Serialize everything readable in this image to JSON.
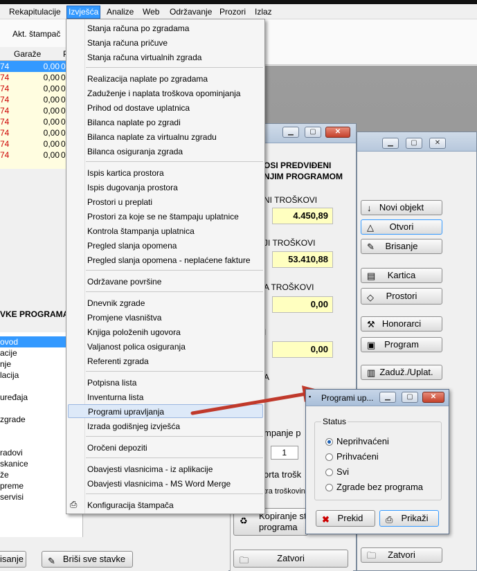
{
  "menubar": {
    "items": [
      "Rekapitulacije",
      "Izvješća",
      "Analize",
      "Web",
      "Održavanje",
      "Prozori",
      "Izlaz"
    ],
    "selected": "Izvješća"
  },
  "toolbar": {
    "label": "Akt. štampač"
  },
  "left_window": {
    "grid_headers": [
      "Garaže",
      "P"
    ],
    "rows": [
      {
        "a": "74",
        "b": "0,00",
        "c": "0,0"
      },
      {
        "a": "74",
        "b": "0,00",
        "c": "0,0"
      },
      {
        "a": "74",
        "b": "0,00",
        "c": "0,0"
      },
      {
        "a": "74",
        "b": "0,00",
        "c": "0,0"
      },
      {
        "a": "74",
        "b": "0,00",
        "c": "0,0"
      },
      {
        "a": "74",
        "b": "0,00",
        "c": "0,0"
      },
      {
        "a": "74",
        "b": "0,00",
        "c": "0,0"
      },
      {
        "a": "74",
        "b": "0,00",
        "c": "0,0"
      },
      {
        "a": "74",
        "b": "0,00",
        "c": "0,0"
      }
    ],
    "stavke_header": "VKE PROGRAMA",
    "stavke_items": [
      "ovod",
      "acije",
      "nje",
      "lacija",
      "uređaja",
      "zgrade",
      "radovi",
      "skanice",
      "že",
      "preme",
      "servisi"
    ],
    "btn_brisanje": "isanje",
    "btn_brisi_sve": "Briši sve stavke"
  },
  "middle_window": {
    "heading1": "OSI PREDVIĐENI",
    "heading2": "NJIM PROGRAMOM",
    "label1": "NI TROŠKOVI",
    "value1": "4.450,89",
    "label2": "JI TROŠKOVI",
    "value2": "53.410,88",
    "label3": "A TROŠKOVI",
    "value3": "0,00",
    "label4": "I",
    "value4": "0,00",
    "label5": "A",
    "stampanje_label": "mpanje p",
    "spinner_value": "1",
    "torta_label": "orta trošk",
    "tra_label": "tra troškovin",
    "btn_kopiranje": "Kopiranje st",
    "btn_kopiranje2": "programa",
    "btn_zatvori": "Zatvori"
  },
  "right_window": {
    "buttons": [
      "Novi objekt",
      "Otvori",
      "Brisanje",
      "Kartica",
      "Prostori",
      "Honorarci",
      "Program",
      "Zaduž./Uplat.",
      "Zatvori"
    ]
  },
  "menu": {
    "groups": [
      [
        "Stanja računa po zgradama",
        "Stanja računa pričuve",
        "Stanja računa virtualnih zgrada"
      ],
      [
        "Realizacija naplate po zgradama",
        "Zaduženje i naplata troškova opominjanja",
        "Prihod od dostave uplatnica",
        "Bilanca naplate po zgradi",
        "Bilanca naplate za virtualnu zgradu",
        "Bilanca osiguranja zgrada"
      ],
      [
        "Ispis kartica prostora",
        "Ispis dugovanja prostora",
        "Prostori u preplati",
        "Prostori za koje se ne štampaju uplatnice",
        "Kontrola štampanja uplatnica",
        "Pregled slanja opomena",
        "Pregled slanja opomena - neplaćene fakture"
      ],
      [
        "Održavane površine"
      ],
      [
        "Dnevnik zgrade",
        "Promjene vlasništva",
        "Knjiga položenih ugovora",
        "Valjanost polica osiguranja",
        "Referenti zgrada"
      ],
      [
        "Potpisna lista",
        "Inventurna lista",
        "Programi upravljanja",
        "Izrada godišnjeg izvješća"
      ],
      [
        "Oročeni depoziti"
      ],
      [
        "Obavjesti vlasnicima - iz aplikacije",
        "Obavjesti vlasnicima - MS Word Merge"
      ],
      [
        "Konfiguracija štampača"
      ]
    ],
    "highlighted": "Programi upravljanja"
  },
  "dialog": {
    "title": "Programi up...",
    "group_label": "Status",
    "options": [
      "Neprihvaćeni",
      "Prihvaćeni",
      "Svi",
      "Zgrade bez programa"
    ],
    "selected_index": 0,
    "btn_prekid": "Prekid",
    "btn_prikazi": "Prikaži"
  },
  "colors": {
    "selection": "#3399ff",
    "arrow": "#c0392b",
    "value_bg": "#ffffc0"
  }
}
